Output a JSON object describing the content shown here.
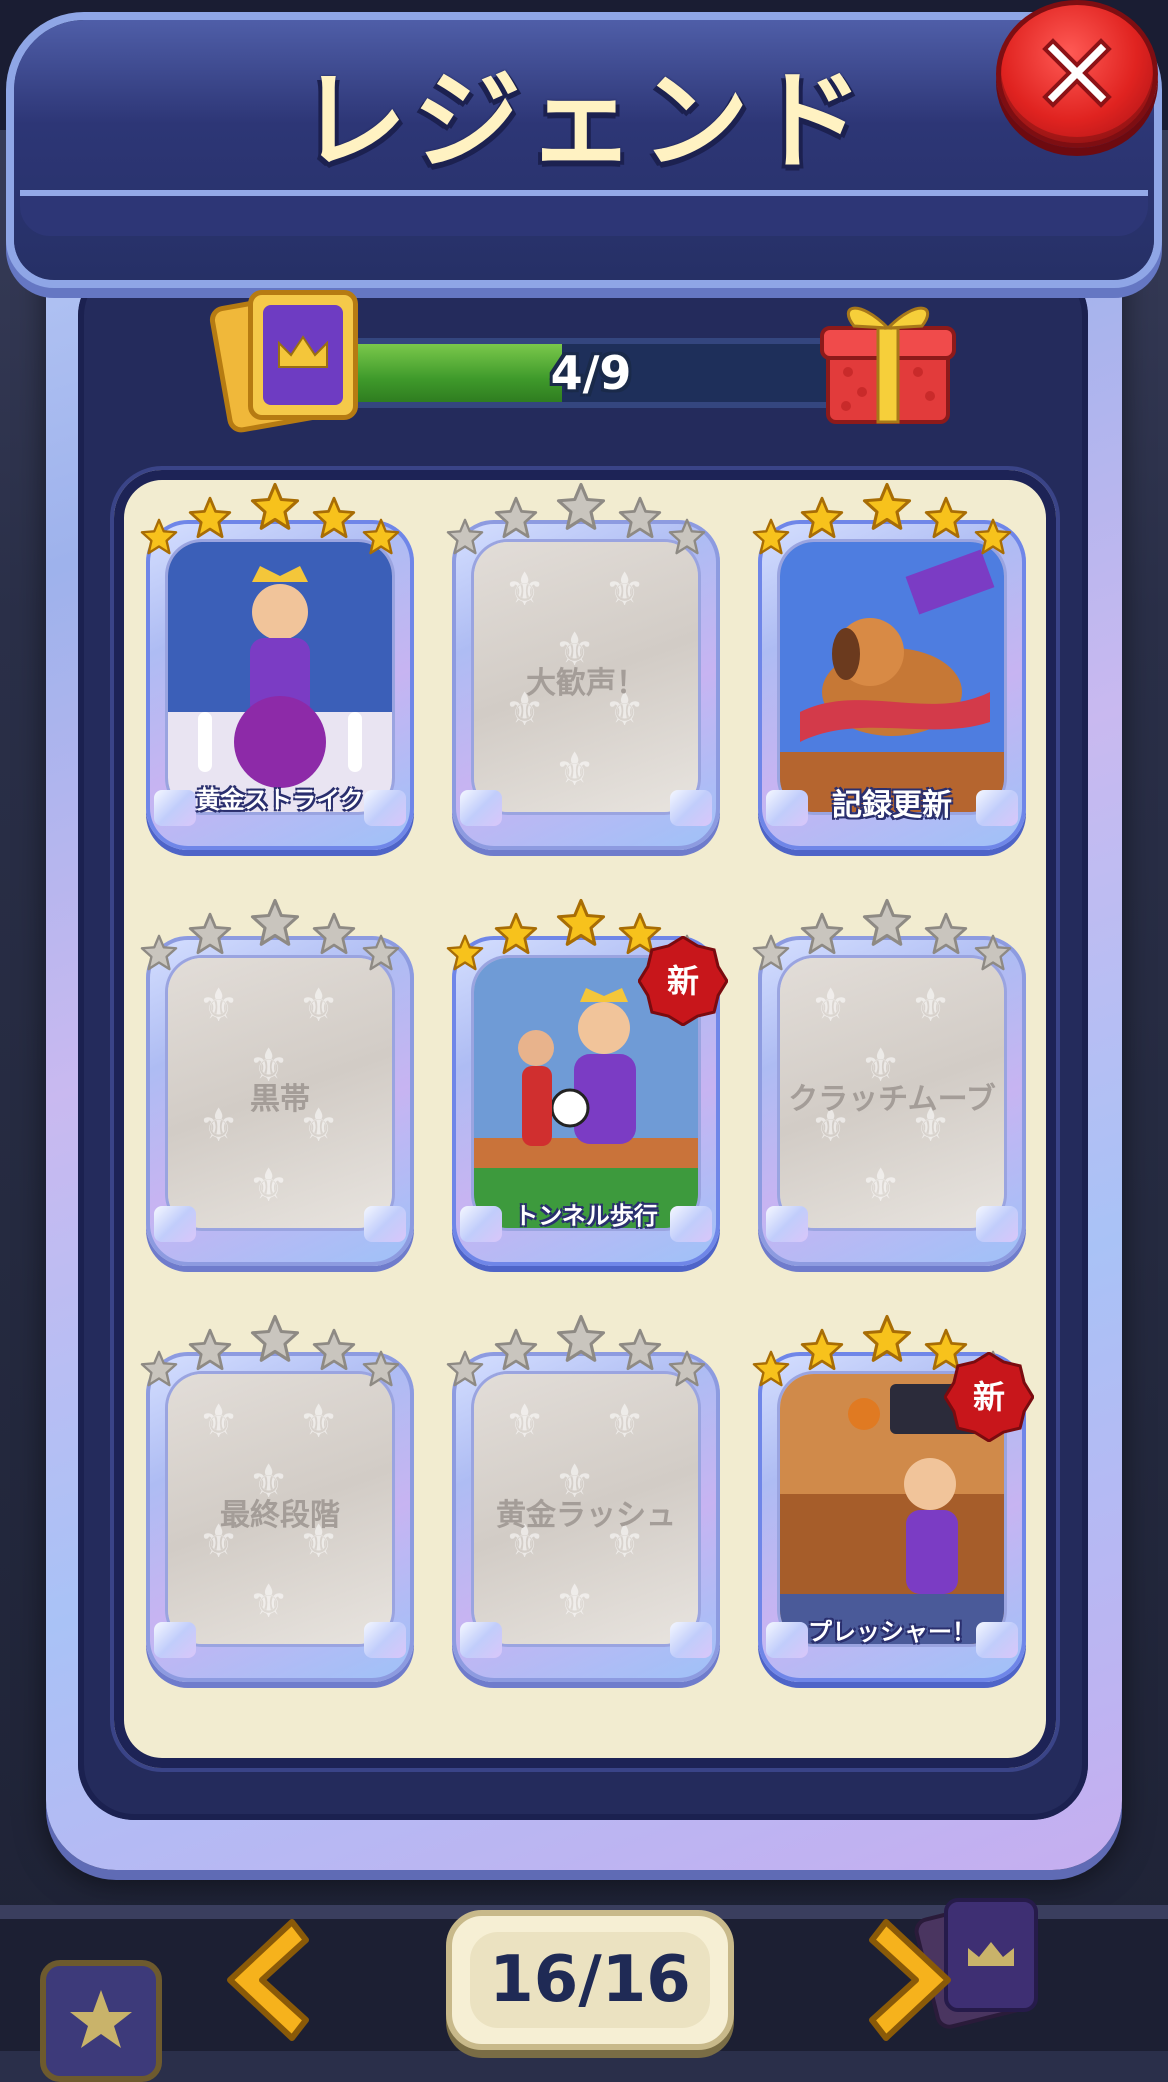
{
  "title": "レジェンド",
  "progress": {
    "text": "4/9",
    "value": 4,
    "max": 9
  },
  "cards": [
    {
      "label": "黄金ストライク",
      "stars": 5,
      "unlocked": true,
      "is_new": false
    },
    {
      "label": "大歓声！",
      "stars": 0,
      "unlocked": false,
      "is_new": false
    },
    {
      "label": "記録更新",
      "stars": 5,
      "unlocked": true,
      "is_new": false
    },
    {
      "label": "黒帯",
      "stars": 0,
      "unlocked": false,
      "is_new": false
    },
    {
      "label": "トンネル歩行",
      "stars": 4,
      "unlocked": true,
      "is_new": true
    },
    {
      "label": "クラッチムーブ",
      "stars": 0,
      "unlocked": false,
      "is_new": false
    },
    {
      "label": "最終段階",
      "stars": 0,
      "unlocked": false,
      "is_new": false
    },
    {
      "label": "黄金ラッシュ",
      "stars": 0,
      "unlocked": false,
      "is_new": false
    },
    {
      "label": "プレッシャー！",
      "stars": 4,
      "unlocked": true,
      "is_new": true
    }
  ],
  "new_badge_text": "新",
  "pager": {
    "text": "16/16"
  },
  "icons": {
    "close": "close-x-icon",
    "card": "crown-card-icon",
    "gift": "gift-box-icon",
    "prev": "chevron-left-icon",
    "next": "chevron-right-icon"
  },
  "colors": {
    "gold_star": "#f7c21c",
    "grey_star": "#c9c5be",
    "new_badge": "#c8161b",
    "progress_fill": "#4fa635"
  }
}
